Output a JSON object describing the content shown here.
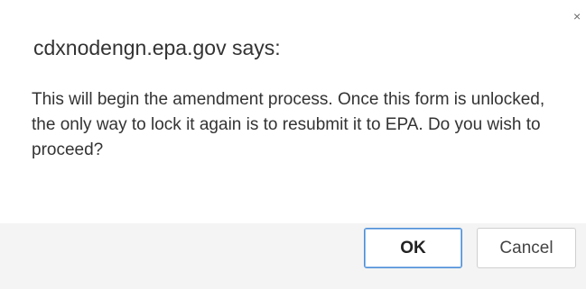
{
  "dialog": {
    "title": "cdxnodengn.epa.gov says:",
    "message": "This will begin the amendment process. Once this form is unlocked, the only way to lock it again is to resubmit it to EPA. Do you wish to proceed?",
    "close_glyph": "×",
    "ok_label": "OK",
    "cancel_label": "Cancel"
  },
  "colors": {
    "ok_border": "#4d8fd6",
    "footer_background": "#f4f4f4",
    "text": "#333333"
  },
  "icons": {
    "close": "close-icon"
  }
}
